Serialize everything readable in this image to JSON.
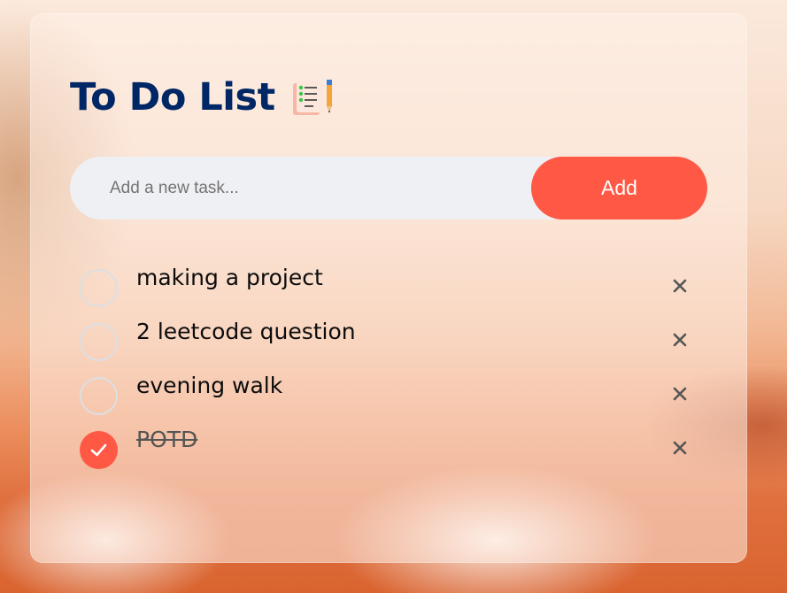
{
  "app": {
    "title": "To Do List"
  },
  "input": {
    "placeholder": "Add a new task...",
    "value": ""
  },
  "add_button": {
    "label": "Add"
  },
  "tasks": [
    {
      "text": "making a project",
      "done": false
    },
    {
      "text": "2 leetcode question",
      "done": false
    },
    {
      "text": "evening walk",
      "done": false
    },
    {
      "text": "POTD",
      "done": true
    }
  ],
  "colors": {
    "title": "#002765",
    "accent": "#ff5945",
    "input_bg": "#eff0f3",
    "unchecked_border": "#dcdfe3",
    "remove_icon": "#555555"
  },
  "icons": {
    "title_icon": "checklist-notepad-pencil-icon",
    "checked_icon": "checkmark-icon",
    "remove_icon": "close-icon"
  }
}
